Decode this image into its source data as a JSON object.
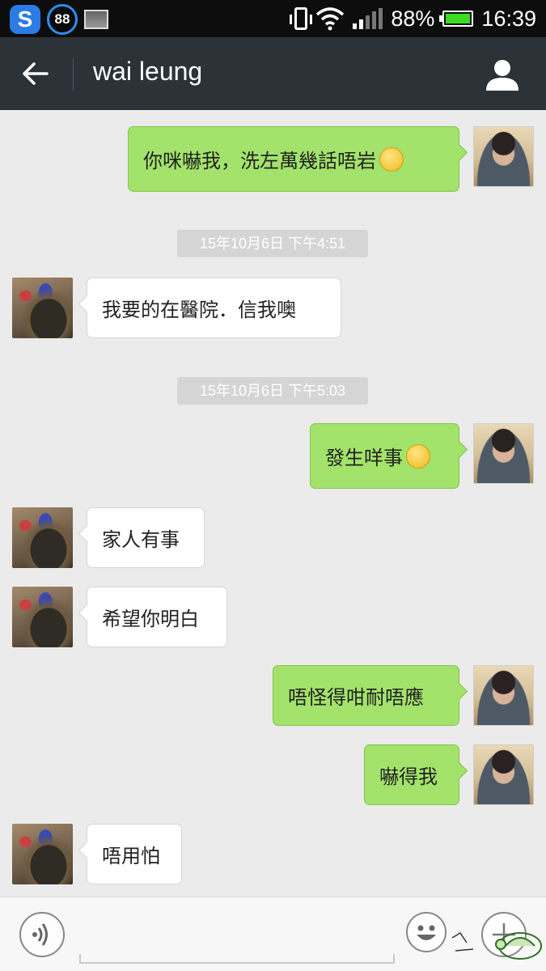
{
  "status_bar": {
    "app_badge": "S",
    "notification_count": "88",
    "battery_percent": "88%",
    "time": "16:39",
    "battery_color": "#3ddc24"
  },
  "header": {
    "back_icon": "arrow-left-icon",
    "title": "wai leung",
    "profile_icon": "person-icon",
    "background": "#2b3238"
  },
  "messages": [
    {
      "sender": "me",
      "text": "你咪嚇我，洗左萬幾話唔岩",
      "emoji": "thinking-emoji"
    },
    {
      "type": "timestamp",
      "text": "15年10月6日 下午4:51"
    },
    {
      "sender": "them",
      "text": "我要的在醫院．信我噢"
    },
    {
      "type": "timestamp",
      "text": "15年10月6日 下午5:03"
    },
    {
      "sender": "me",
      "text": "發生咩事",
      "emoji": "crying-emoji"
    },
    {
      "sender": "them",
      "text": "家人有事"
    },
    {
      "sender": "them",
      "text": "希望你明白"
    },
    {
      "sender": "me",
      "text": "唔怪得咁耐唔應"
    },
    {
      "sender": "me",
      "text": "嚇得我"
    },
    {
      "sender": "them",
      "text": "唔用怕"
    }
  ],
  "colors": {
    "my_bubble": "#a3e36b",
    "their_bubble": "#ffffff",
    "chat_background": "#ebebeb"
  },
  "input_bar": {
    "voice_icon": "voice-icon",
    "emoji_icon": "smiley-icon",
    "plus_icon": "plus-icon",
    "text_value": ""
  }
}
